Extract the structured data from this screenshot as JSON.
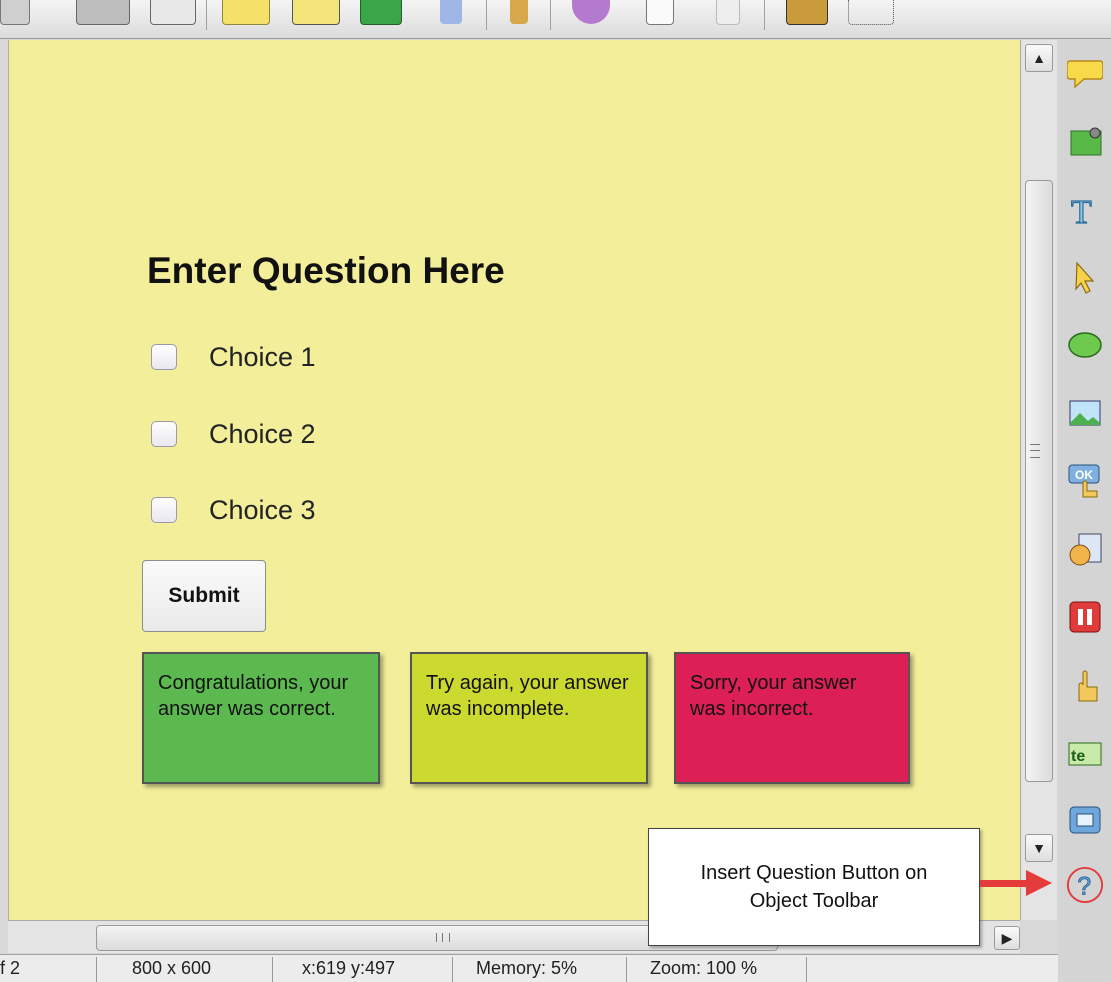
{
  "canvas": {
    "question_title": "Enter Question Here",
    "choices": [
      {
        "label": "Choice 1"
      },
      {
        "label": "Choice 2"
      },
      {
        "label": "Choice 3"
      }
    ],
    "submit_label": "Submit",
    "feedback": {
      "correct": "Congratulations, your answer was correct.",
      "incomplete": "Try again, your answer was incomplete.",
      "incorrect": "Sorry, your answer was incorrect."
    },
    "background_color": "#f2ee9a"
  },
  "callout": {
    "line1": "Insert Question Button on",
    "line2": "Object Toolbar"
  },
  "object_toolbar": {
    "items": [
      "caption-icon",
      "highlight-box-icon",
      "text-icon",
      "cursor-icon",
      "rollover-icon",
      "image-icon",
      "ok-button-icon",
      "animation-icon",
      "pause-icon",
      "click-box-icon",
      "text-entry-icon",
      "zoom-icon",
      "insert-question-icon"
    ]
  },
  "status_bar": {
    "slide": "f 2",
    "size": "800 x 600",
    "coords": "x:619 y:497",
    "memory": "Memory: 5%",
    "zoom": "Zoom: 100 %"
  },
  "colors": {
    "correct": "#5cb94f",
    "incomplete": "#ccd92e",
    "incorrect": "#dc1f55",
    "arrow": "#e43b3b"
  }
}
